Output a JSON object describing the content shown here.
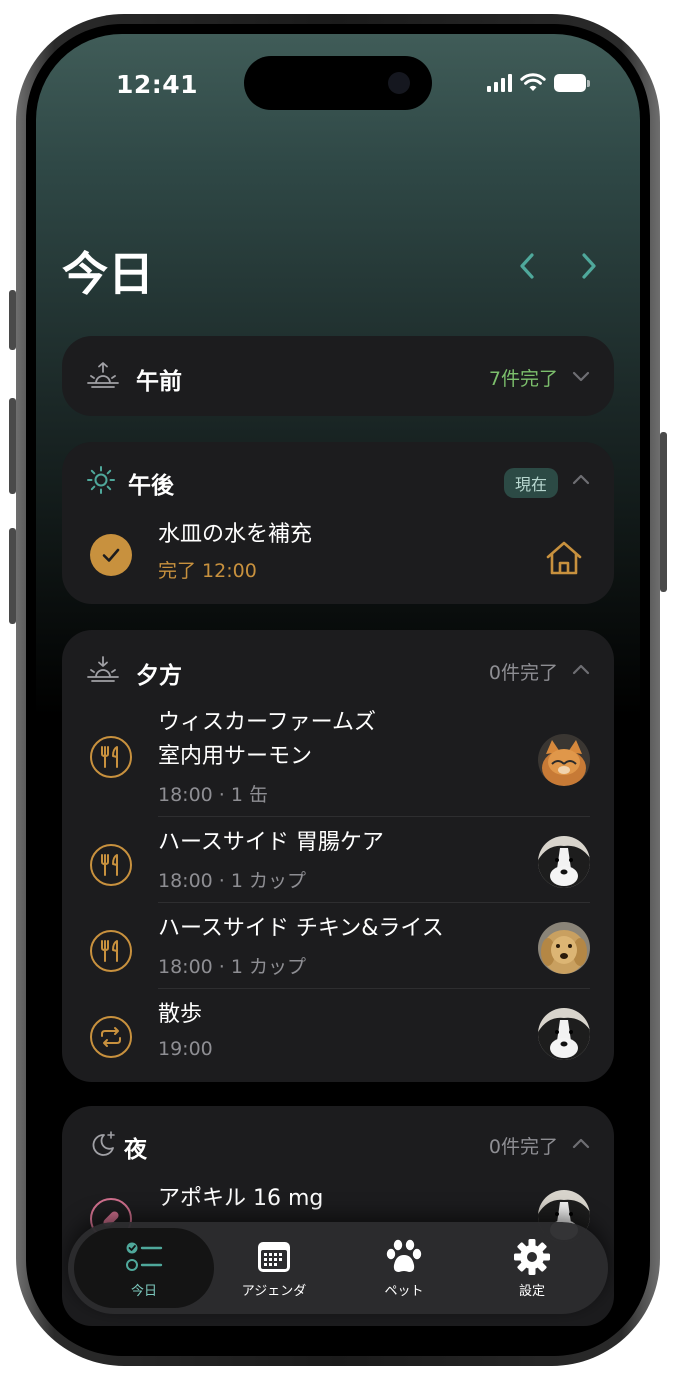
{
  "status_bar": {
    "time": "12:41"
  },
  "header": {
    "title": "今日"
  },
  "colors": {
    "accent_teal": "#4fa89b",
    "gold": "#c8913e",
    "green_count": "#7cbf6c",
    "card_bg": "#1c1c1e",
    "pink": "#d0708e"
  },
  "sections": {
    "morning": {
      "title": "午前",
      "count": "7件完了",
      "icon": "sunrise-icon",
      "expanded": false
    },
    "afternoon": {
      "title": "午後",
      "badge": "現在",
      "icon": "sun-icon",
      "expanded": true,
      "tasks": [
        {
          "name": "水皿の水を補充",
          "meta": "完了 12:00",
          "icon": "check-icon",
          "right_icon": "home-icon"
        }
      ]
    },
    "evening": {
      "title": "夕方",
      "count": "0件完了",
      "icon": "sunset-icon",
      "expanded": true,
      "tasks": [
        {
          "name_line1": "ウィスカーファームズ",
          "name_line2": "室内用サーモン",
          "meta": "18:00 · 1 缶",
          "icon": "fork-knife-icon",
          "avatar": "orange-cat-avatar"
        },
        {
          "name": "ハースサイド 胃腸ケア",
          "meta": "18:00 · 1 カップ",
          "icon": "fork-knife-icon",
          "avatar": "border-collie-avatar"
        },
        {
          "name": "ハースサイド チキン&ライス",
          "meta": "18:00 · 1 カップ",
          "icon": "fork-knife-icon",
          "avatar": "golden-retriever-avatar"
        },
        {
          "name": "散歩",
          "meta": "19:00",
          "icon": "repeat-icon",
          "avatar": "border-collie-avatar"
        }
      ]
    },
    "night": {
      "title": "夜",
      "count": "0件完了",
      "icon": "moon-icon",
      "expanded": true,
      "tasks": [
        {
          "name": "アポキル 16 mg",
          "icon": "pill-icon",
          "avatar": "border-collie-avatar"
        }
      ]
    }
  },
  "tabbar": {
    "tabs": [
      {
        "label": "今日",
        "icon": "checklist-icon",
        "active": true
      },
      {
        "label": "アジェンダ",
        "icon": "calendar-icon",
        "active": false
      },
      {
        "label": "ペット",
        "icon": "paw-icon",
        "active": false
      },
      {
        "label": "設定",
        "icon": "gear-icon",
        "active": false
      }
    ]
  }
}
